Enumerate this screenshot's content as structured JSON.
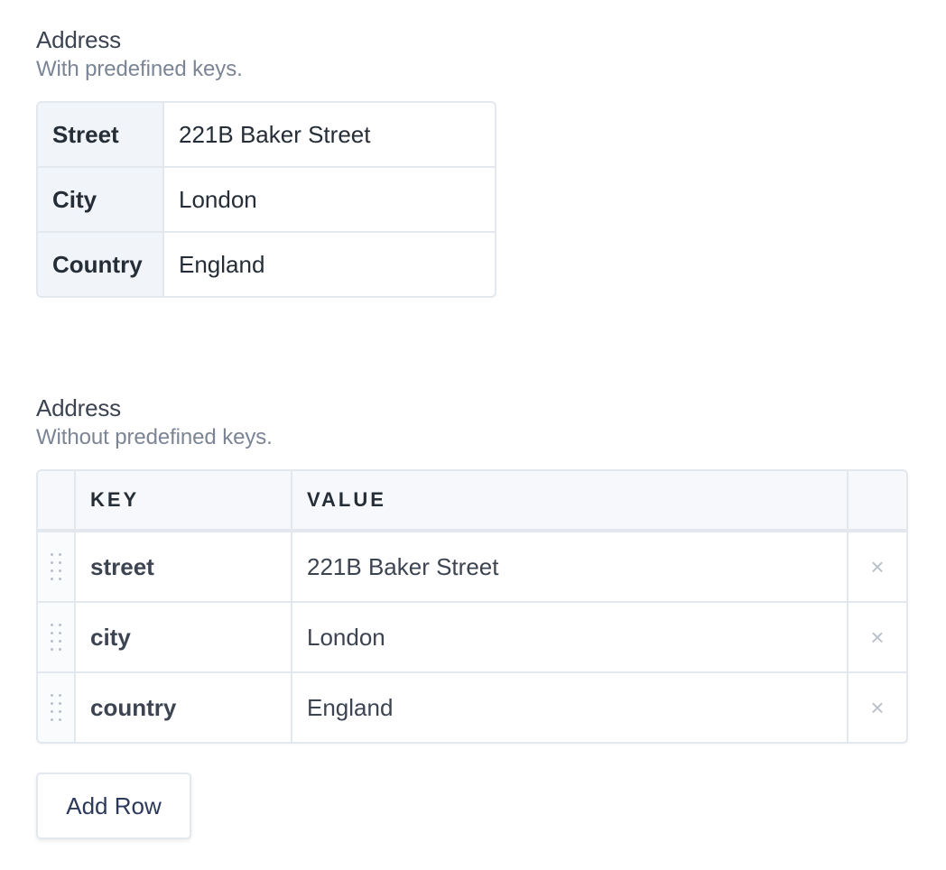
{
  "predefined": {
    "label": "Address",
    "help": "With predefined keys.",
    "rows": [
      {
        "key": "Street",
        "value": "221B Baker Street"
      },
      {
        "key": "City",
        "value": "London"
      },
      {
        "key": "Country",
        "value": "England"
      }
    ]
  },
  "dynamic": {
    "label": "Address",
    "help": "Without predefined keys.",
    "columns": {
      "key": "KEY",
      "value": "VALUE"
    },
    "rows": [
      {
        "key": "street",
        "value": "221B Baker Street",
        "delete_icon": "×"
      },
      {
        "key": "city",
        "value": "London",
        "delete_icon": "×"
      },
      {
        "key": "country",
        "value": "England",
        "delete_icon": "×"
      }
    ],
    "add_row_label": "Add Row"
  },
  "colors": {
    "border": "#e3e7ee",
    "key_background": "#f1f4f8",
    "help_text": "#7b8595",
    "icon": "#b9c0cb"
  }
}
